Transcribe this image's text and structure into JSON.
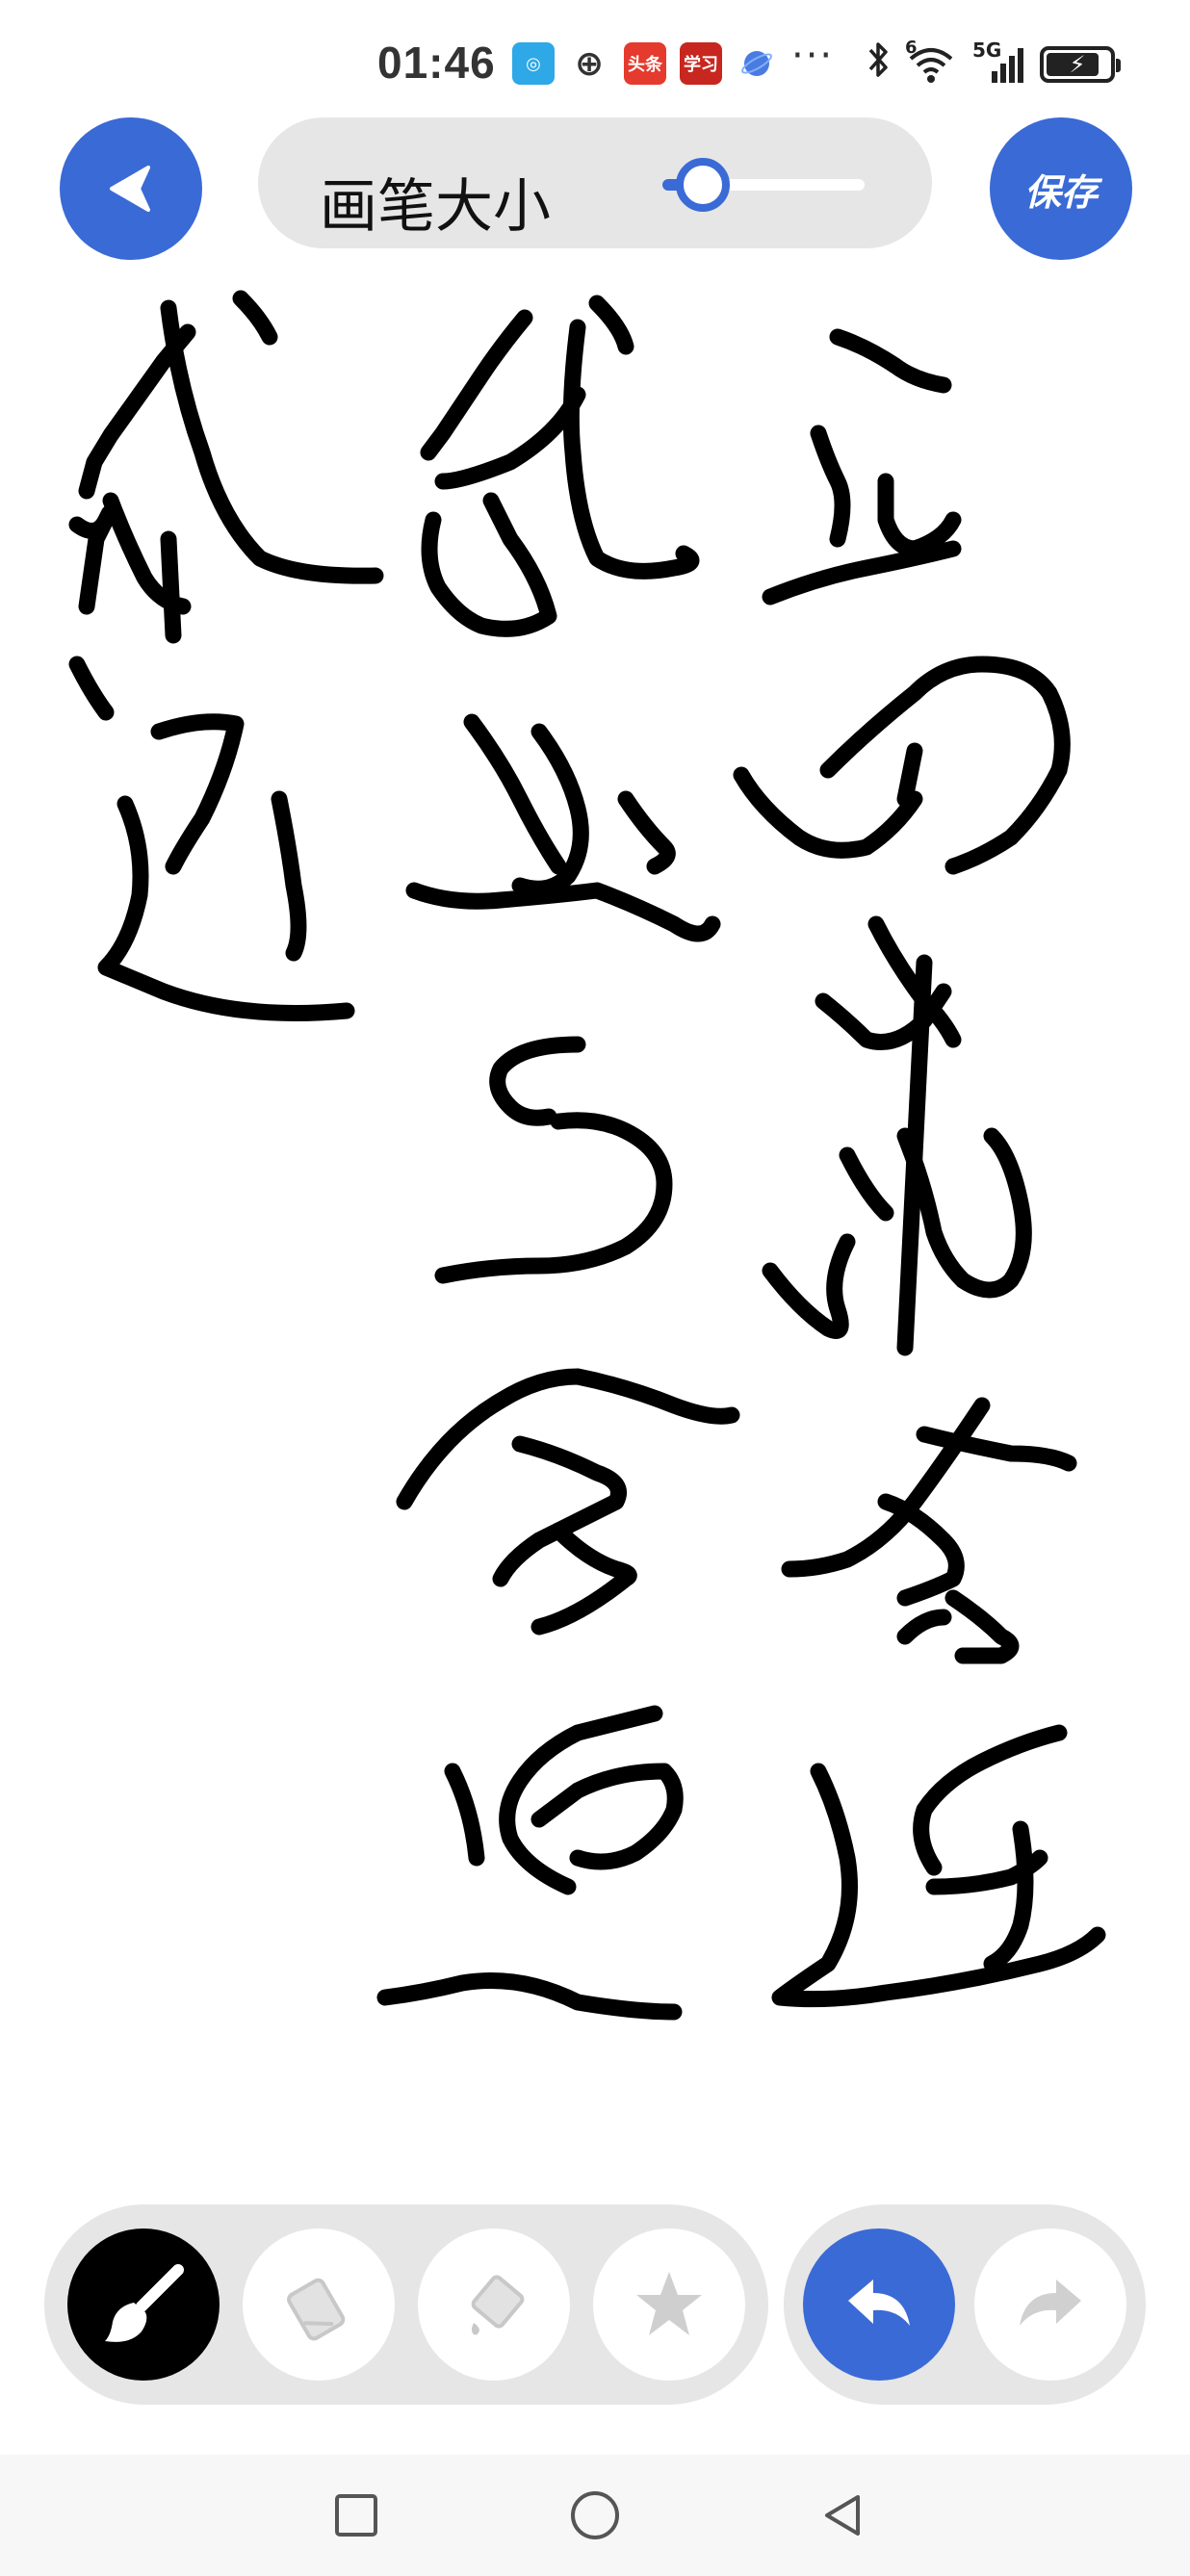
{
  "status_bar": {
    "time": "01:46",
    "notification_icons": [
      "app-icon",
      "globe-icon",
      "toutiao-icon",
      "xuexi-icon",
      "planet-icon"
    ],
    "toutiao_label": "头条",
    "xuexi_label": "学习",
    "more": "···",
    "network_sub": "6",
    "network": "5G",
    "battery_fraction": 0.85
  },
  "header": {
    "brush_size_label": "画笔大小",
    "brush_size_value": 0.2,
    "save_label": "保存"
  },
  "canvas": {
    "description_icon": "handwritten-calligraphy-strokes"
  },
  "toolbar": {
    "tools": [
      "brush-icon",
      "eraser-icon",
      "fill-bucket-icon",
      "sticker-star-icon"
    ],
    "active_tool": "brush-icon",
    "history": [
      "undo-icon",
      "redo-icon"
    ]
  },
  "navigation": {
    "buttons": [
      "recent-apps-icon",
      "home-icon",
      "back-icon"
    ]
  },
  "colors": {
    "accent": "#3a6ad6",
    "pill_background": "#e6e6e6",
    "ink": "#000000"
  }
}
